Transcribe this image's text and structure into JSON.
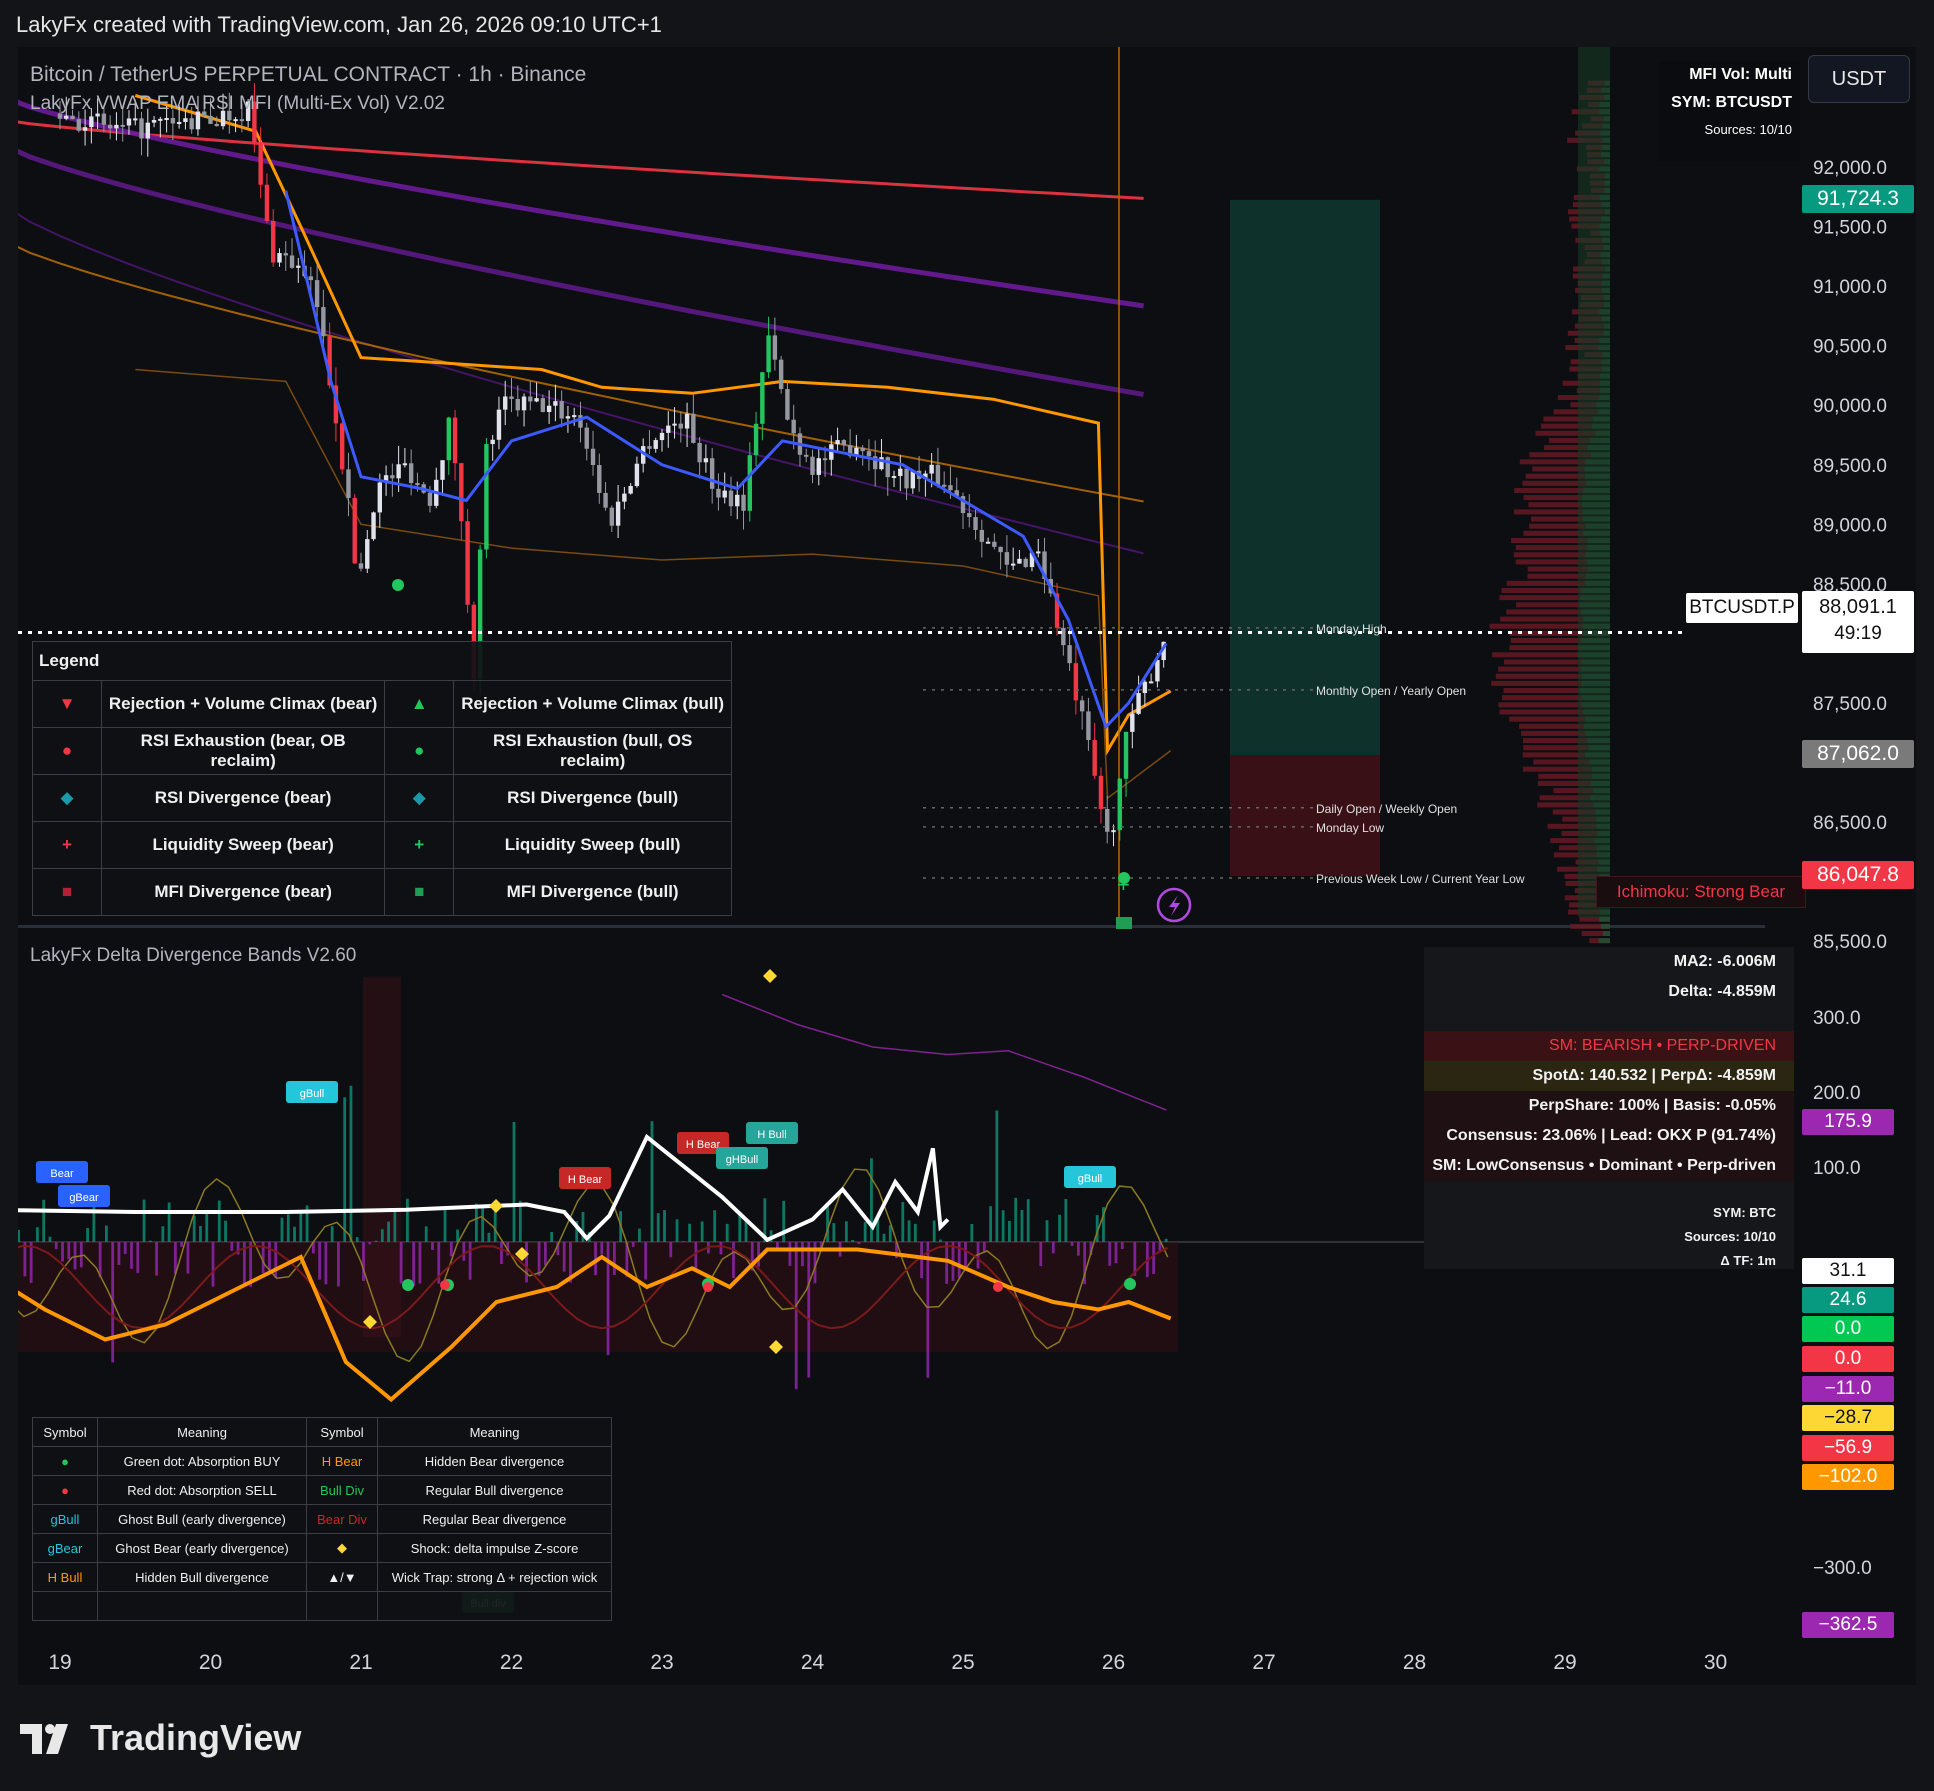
{
  "header": {
    "credit": "LakyFx created with TradingView.com, Jan 26, 2026 09:10 UTC+1"
  },
  "main": {
    "symbol_title": "Bitcoin / TetherUS PERPETUAL CONTRACT · 1h · Binance",
    "indicator_title": "LakyFx VWAP EMA RSI MFI (Multi-Ex Vol) V2.02",
    "currency": "USDT",
    "mfi_box": {
      "line1": "MFI Vol: Multi",
      "line2": "SYM: BTCUSDT",
      "line3": "Sources: 10/10"
    },
    "ichimoku": "Ichimoku: Strong Bear",
    "symbol_tag": "BTCUSDT.P",
    "last_price": "88,091.1",
    "countdown": "49:19",
    "price_badges": [
      {
        "label": "91,724.3",
        "price": 91724.3,
        "color": "#089981"
      },
      {
        "label": "87,062.0",
        "price": 87062.0,
        "color": "#7a7a7a"
      },
      {
        "label": "86,047.8",
        "price": 86047.8,
        "color": "#f23645"
      }
    ],
    "level_labels": [
      {
        "text": "Monday High",
        "price": 88130
      },
      {
        "text": "Monthly Open / Yearly Open",
        "price": 87610
      },
      {
        "text": "Daily Open / Weekly Open",
        "price": 86620
      },
      {
        "text": "Monday Low",
        "price": 86460
      },
      {
        "text": "Previous Week Low / Current Year Low",
        "price": 86030
      }
    ],
    "legend": {
      "title": "Legend",
      "rows": [
        {
          "sym_l": "▼",
          "col_l": "#f23645",
          "text_l": "Rejection + Volume Climax (bear)",
          "sym_r": "▲",
          "col_r": "#22c55e",
          "text_r": "Rejection + Volume Climax (bull)"
        },
        {
          "sym_l": "●",
          "col_l": "#f23645",
          "text_l": "RSI Exhaustion (bear, OB reclaim)",
          "sym_r": "●",
          "col_r": "#22c55e",
          "text_r": "RSI Exhaustion (bull, OS reclaim)"
        },
        {
          "sym_l": "◆",
          "col_l": "#1a9aa8",
          "text_l": "RSI Divergence (bear)",
          "sym_r": "◆",
          "col_r": "#1a9aa8",
          "text_r": "RSI Divergence (bull)"
        },
        {
          "sym_l": "+",
          "col_l": "#f23645",
          "text_l": "Liquidity Sweep (bear)",
          "sym_r": "+",
          "col_r": "#22c55e",
          "text_r": "Liquidity Sweep (bull)"
        },
        {
          "sym_l": "■",
          "col_l": "#b22234",
          "text_l": "MFI Divergence (bear)",
          "sym_r": "■",
          "col_r": "#1f9d55",
          "text_r": "MFI Divergence (bull)"
        }
      ]
    }
  },
  "delta": {
    "title": "LakyFx Delta Divergence Bands V2.60",
    "info": {
      "ma2": "MA2: -6.006M",
      "delta": "Delta: -4.859M",
      "sm": "SM: BEARISH  •  PERP-DRIVEN",
      "spot": "SpotΔ: 140.532 | PerpΔ: -4.859M",
      "perpshare": "PerpShare: 100% | Basis: -0.05%",
      "consensus": "Consensus: 23.06% | Lead: OKX P (91.74%)",
      "sm2": "SM: LowConsensus • Dominant • Perp-driven",
      "sym": "SYM: BTC",
      "sources": "Sources: 10/10",
      "tf": "Δ TF: 1m"
    },
    "badges": [
      {
        "label": "175.9",
        "value": 175.9,
        "color": "#9c27b0",
        "fg": "#ffffff"
      },
      {
        "label": "31.1",
        "value": 31.1,
        "color": "#ffffff",
        "fg": "#111111"
      },
      {
        "label": "24.6",
        "value": 24.6,
        "color": "#089981",
        "fg": "#ffffff"
      },
      {
        "label": "0.0",
        "value": 0.0,
        "color": "#00c853",
        "fg": "#ffffff"
      },
      {
        "label": "0.0",
        "value": -0.01,
        "color": "#f23645",
        "fg": "#ffffff"
      },
      {
        "label": "−11.0",
        "value": -11.0,
        "color": "#9c27b0",
        "fg": "#ffffff"
      },
      {
        "label": "−28.7",
        "value": -28.7,
        "color": "#fdd835",
        "fg": "#111111"
      },
      {
        "label": "−56.9",
        "value": -56.9,
        "color": "#f23645",
        "fg": "#ffffff"
      },
      {
        "label": "−102.0",
        "value": -102.0,
        "color": "#ff9800",
        "fg": "#ffffff"
      },
      {
        "label": "−362.5",
        "value": -362.5,
        "color": "#9c27b0",
        "fg": "#ffffff"
      }
    ],
    "chip_labels": {
      "bear": "Bear",
      "gBear": "gBear",
      "gBull": "gBull",
      "HBear": "H Bear",
      "HBull": "H Bull",
      "gHBull": "gHBull",
      "BullDiv": "Bull div"
    },
    "legend": {
      "headers": [
        "Symbol",
        "Meaning",
        "Symbol",
        "Meaning"
      ],
      "rows": [
        {
          "s1": "●",
          "c1": "#22c55e",
          "m1": "Green dot: Absorption BUY",
          "s2": "H Bear",
          "c2": "#ff9800",
          "m2": "Hidden Bear divergence"
        },
        {
          "s1": "●",
          "c1": "#f23645",
          "m1": "Red dot: Absorption SELL",
          "s2": "Bull Div",
          "c2": "#22c55e",
          "m2": "Regular Bull divergence"
        },
        {
          "s1": "gBull",
          "c1": "#26c6da",
          "m1": "Ghost Bull (early divergence)",
          "s2": "Bear Div",
          "c2": "#c62828",
          "m2": "Regular Bear divergence"
        },
        {
          "s1": "gBear",
          "c1": "#26c6da",
          "m1": "Ghost Bear (early divergence)",
          "s2": "◆",
          "c2": "#fdd835",
          "m2": "Shock: delta impulse Z-score"
        },
        {
          "s1": "H Bull",
          "c1": "#ff9800",
          "m1": "Hidden Bull divergence",
          "s2": "▲/▼",
          "c2": "#f0f0f0",
          "m2": "Wick Trap: strong Δ + rejection wick"
        },
        {
          "s1": "",
          "c1": "#f0f0f0",
          "m1": "",
          "s2": "",
          "c2": "#f0f0f0",
          "m2": ""
        }
      ]
    }
  },
  "footer": {
    "brand": "TradingView"
  },
  "chart_data": [
    {
      "type": "candlestick",
      "title": "Bitcoin / TetherUS PERPETUAL CONTRACT · 1h · Binance",
      "x_ticks": [
        "19",
        "20",
        "21",
        "22",
        "23",
        "24",
        "25",
        "26",
        "27",
        "28",
        "29",
        "30"
      ],
      "y_ticks": [
        "92,000.0",
        "91,500.0",
        "91,000.0",
        "90,500.0",
        "90,000.0",
        "89,500.0",
        "89,000.0",
        "88,500.0",
        "87,500.0",
        "86,500.0",
        "85,500.0"
      ],
      "y_tick_values": [
        92000,
        91500,
        91000,
        90500,
        90000,
        89500,
        89000,
        88500,
        87500,
        86500,
        85500
      ],
      "ylim": [
        85430,
        92740
      ],
      "close_path_keypoints": [
        {
          "day": 19.0,
          "price": 92450
        },
        {
          "day": 19.4,
          "price": 92300
        },
        {
          "day": 20.0,
          "price": 92400
        },
        {
          "day": 20.25,
          "price": 92500
        },
        {
          "day": 20.4,
          "price": 91300
        },
        {
          "day": 20.55,
          "price": 91200
        },
        {
          "day": 20.7,
          "price": 90900
        },
        {
          "day": 20.85,
          "price": 89800
        },
        {
          "day": 20.98,
          "price": 88500
        },
        {
          "day": 21.1,
          "price": 89300
        },
        {
          "day": 21.3,
          "price": 89500
        },
        {
          "day": 21.45,
          "price": 89200
        },
        {
          "day": 21.6,
          "price": 89900
        },
        {
          "day": 21.75,
          "price": 87800
        },
        {
          "day": 21.83,
          "price": 89600
        },
        {
          "day": 21.95,
          "price": 90000
        },
        {
          "day": 22.2,
          "price": 90000
        },
        {
          "day": 22.45,
          "price": 89900
        },
        {
          "day": 22.65,
          "price": 89000
        },
        {
          "day": 22.9,
          "price": 89700
        },
        {
          "day": 23.15,
          "price": 89900
        },
        {
          "day": 23.35,
          "price": 89300
        },
        {
          "day": 23.55,
          "price": 89200
        },
        {
          "day": 23.7,
          "price": 90600
        },
        {
          "day": 23.85,
          "price": 89800
        },
        {
          "day": 24.0,
          "price": 89500
        },
        {
          "day": 24.3,
          "price": 89700
        },
        {
          "day": 24.55,
          "price": 89400
        },
        {
          "day": 24.85,
          "price": 89400
        },
        {
          "day": 25.1,
          "price": 89000
        },
        {
          "day": 25.3,
          "price": 88600
        },
        {
          "day": 25.5,
          "price": 88800
        },
        {
          "day": 25.68,
          "price": 87900
        },
        {
          "day": 25.8,
          "price": 87300
        },
        {
          "day": 25.97,
          "price": 86300
        },
        {
          "day": 26.1,
          "price": 87300
        },
        {
          "day": 26.2,
          "price": 87600
        },
        {
          "day": 26.35,
          "price": 88090
        }
      ],
      "vwap_blue": [
        {
          "day": 20.5,
          "price": 91800
        },
        {
          "day": 20.8,
          "price": 90200
        },
        {
          "day": 21.0,
          "price": 89400
        },
        {
          "day": 21.4,
          "price": 89300
        },
        {
          "day": 21.7,
          "price": 89200
        },
        {
          "day": 22.0,
          "price": 89700
        },
        {
          "day": 22.5,
          "price": 89900
        },
        {
          "day": 23.0,
          "price": 89500
        },
        {
          "day": 23.5,
          "price": 89300
        },
        {
          "day": 23.8,
          "price": 89700
        },
        {
          "day": 24.2,
          "price": 89600
        },
        {
          "day": 24.6,
          "price": 89500
        },
        {
          "day": 25.0,
          "price": 89200
        },
        {
          "day": 25.4,
          "price": 88900
        },
        {
          "day": 25.7,
          "price": 88200
        },
        {
          "day": 25.95,
          "price": 87300
        },
        {
          "day": 26.1,
          "price": 87500
        },
        {
          "day": 26.35,
          "price": 88000
        }
      ],
      "long_position": {
        "entry": 87062.0,
        "target": 91724.3,
        "stop": 86047.8
      },
      "current_price": 88091.1
    },
    {
      "type": "line",
      "title": "LakyFx Delta Divergence Bands V2.60",
      "y_ticks": [
        "300.0",
        "200.0",
        "100.0",
        "−300.0"
      ],
      "y_tick_values": [
        300,
        200,
        100,
        -300
      ],
      "ylim": [
        -375,
        345
      ],
      "series": [
        {
          "color": "#ffffff",
          "points": [
            {
              "day": 18.5,
              "value": 43
            },
            {
              "day": 19.5,
              "value": 40
            },
            {
              "day": 20.5,
              "value": 40
            },
            {
              "day": 21.3,
              "value": 43
            },
            {
              "day": 22.1,
              "value": 50
            },
            {
              "day": 22.35,
              "value": 40
            },
            {
              "day": 22.5,
              "value": 5
            },
            {
              "day": 22.65,
              "value": 35
            },
            {
              "day": 22.9,
              "value": 140
            },
            {
              "day": 23.4,
              "value": 60
            },
            {
              "day": 23.7,
              "value": 3
            },
            {
              "day": 24.0,
              "value": 30
            },
            {
              "day": 24.2,
              "value": 70
            },
            {
              "day": 24.4,
              "value": 20
            },
            {
              "day": 24.55,
              "value": 80
            },
            {
              "day": 24.7,
              "value": 40
            },
            {
              "day": 24.8,
              "value": 125
            },
            {
              "day": 24.85,
              "value": 20
            },
            {
              "day": 24.9,
              "value": 30
            }
          ]
        },
        {
          "color": "#ff9800",
          "points": [
            {
              "day": 18.5,
              "value": -40
            },
            {
              "day": 18.9,
              "value": -90
            },
            {
              "day": 19.3,
              "value": -130
            },
            {
              "day": 19.7,
              "value": -110
            },
            {
              "day": 20.2,
              "value": -60
            },
            {
              "day": 20.6,
              "value": -20
            },
            {
              "day": 20.9,
              "value": -160
            },
            {
              "day": 21.2,
              "value": -210
            },
            {
              "day": 21.6,
              "value": -140
            },
            {
              "day": 21.9,
              "value": -80
            },
            {
              "day": 22.3,
              "value": -60
            },
            {
              "day": 22.6,
              "value": -20
            },
            {
              "day": 22.9,
              "value": -60
            },
            {
              "day": 23.2,
              "value": -35
            },
            {
              "day": 23.45,
              "value": -60
            },
            {
              "day": 23.7,
              "value": -10
            },
            {
              "day": 24.3,
              "value": -10
            },
            {
              "day": 24.9,
              "value": -25
            },
            {
              "day": 25.3,
              "value": -60
            },
            {
              "day": 25.6,
              "value": -80
            },
            {
              "day": 25.9,
              "value": -90
            },
            {
              "day": 26.1,
              "value": -80
            },
            {
              "day": 26.38,
              "value": -102
            }
          ]
        },
        {
          "color": "#9c27b0",
          "points": [
            {
              "day": 23.4,
              "value": 330
            },
            {
              "day": 23.9,
              "value": 290
            },
            {
              "day": 24.4,
              "value": 260
            },
            {
              "day": 24.9,
              "value": 250
            },
            {
              "day": 25.3,
              "value": 255
            },
            {
              "day": 25.8,
              "value": 220
            },
            {
              "day": 26.35,
              "value": 176
            }
          ]
        }
      ]
    }
  ]
}
